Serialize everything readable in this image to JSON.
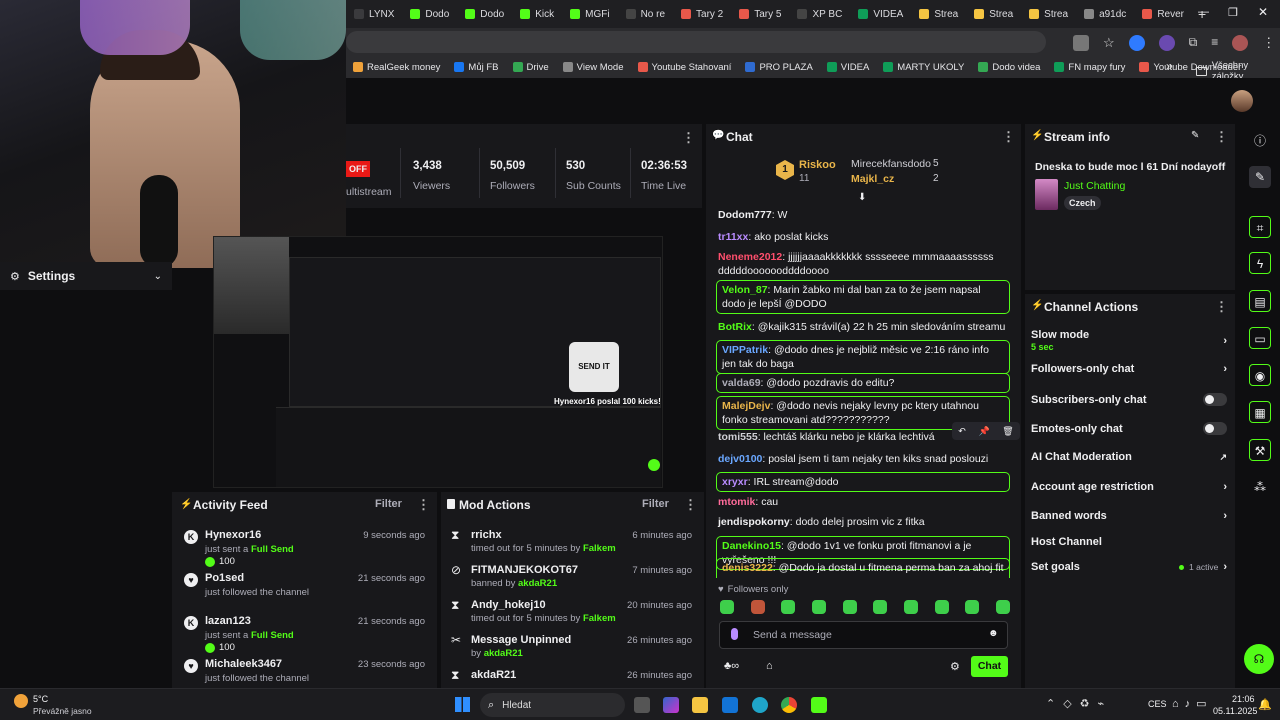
{
  "browser": {
    "tabs": [
      "LYNX",
      "Dodo",
      "Dodo",
      "Kick",
      "MGFi",
      "No re",
      "Tary 2",
      "Tary 5",
      "XP BC",
      "VIDEA",
      "Strea",
      "Strea",
      "Strea",
      "a91dc",
      "Rever"
    ],
    "new_tab": "+",
    "bookmarks": [
      "RealGeek money",
      "Můj FB",
      "Drive",
      "View Mode",
      "Youtube Stahovaní",
      "PRO PLAZA",
      "VIDEA",
      "MARTY UKOLY",
      "Dodo videa",
      "FN mapy fury",
      "Youtube Downloader"
    ],
    "bookmarks_more": "»",
    "all_bookmarks": "Všechny záložky"
  },
  "settings": {
    "label": "Settings"
  },
  "stats": {
    "multistream": "ultistream",
    "off_badge": "OFF",
    "items": [
      {
        "value": "3,438",
        "label": "Viewers"
      },
      {
        "value": "50,509",
        "label": "Followers"
      },
      {
        "value": "530",
        "label": "Sub Counts"
      },
      {
        "value": "02:36:53",
        "label": "Time Live"
      }
    ]
  },
  "preview": {
    "overlay_text": "Hynexor16 poslal 100 kicks!",
    "sendit": "SEND IT"
  },
  "activity": {
    "title": "Activity Feed",
    "filter": "Filter",
    "rows": [
      {
        "name": "Hynexor16",
        "text": "just sent a",
        "highlight": "Full Send",
        "amount": "100",
        "time": "9 seconds ago"
      },
      {
        "name": "Po1sed",
        "text": "just followed the channel",
        "time": "21 seconds ago"
      },
      {
        "name": "lazan123",
        "text": "just sent a",
        "highlight": "Full Send",
        "amount": "100",
        "time": "21 seconds ago"
      },
      {
        "name": "Michaleek3467",
        "text": "just followed the channel",
        "time": "23 seconds ago"
      }
    ]
  },
  "mod_actions": {
    "title": "Mod Actions",
    "filter": "Filter",
    "rows": [
      {
        "name": "rrichx",
        "text": "timed out for 5 minutes by",
        "by": "Falkem",
        "time": "6 minutes ago"
      },
      {
        "name": "FITMANJEKOKOT67",
        "text": "banned by",
        "by": "akdaR21",
        "time": "7 minutes ago"
      },
      {
        "name": "Andy_hokej10",
        "text": "timed out for 5 minutes by",
        "by": "Falkem",
        "time": "20 minutes ago"
      },
      {
        "name": "Message Unpinned",
        "text": "by",
        "by": "akdaR21",
        "time": "26 minutes ago"
      },
      {
        "name": "akdaR21",
        "text": "",
        "by": "",
        "time": "26 minutes ago"
      }
    ]
  },
  "chat": {
    "title": "Chat",
    "leaderboard": {
      "first": "Riskoo",
      "first_count": "11",
      "first_rank": "1",
      "second": "Mirecekfansdodo",
      "second_count": "5",
      "third": "Majkl_cz",
      "third_count": "2"
    },
    "messages": [
      {
        "user": "Dodom777",
        "color": "#efeff1",
        "text": "W",
        "boxed": false
      },
      {
        "user": "tr11xx",
        "color": "#b98cff",
        "text": "ako poslat kicks",
        "boxed": false
      },
      {
        "user": "Neneme2012",
        "color": "#ff4f6d",
        "text": "jjjjjjaaaakkkkkkk sssseeee mmmaaaassssss dddddooooooddddoooo",
        "boxed": false
      },
      {
        "user": "Velon_87",
        "color": "#53fc18",
        "text": "Marin žabko mi dal ban za to že jsem napsal dodo je lepšÍ @DODO",
        "boxed": true
      },
      {
        "user": "BotRix",
        "color": "#53fc18",
        "text": "@kajik315 strávil(a) 22 h 25 min sledováním streamu",
        "boxed": false
      },
      {
        "user": "VIPPatrik",
        "color": "#6aa7ff",
        "text": "@dodo dnes je nejbliž měsic ve 2:16 ráno info jen tak do baga",
        "boxed": true
      },
      {
        "user": "valda69",
        "color": "#adadb8",
        "text": "@dodo pozdravis do editu?",
        "boxed": true
      },
      {
        "user": "MalejDejv",
        "color": "#e9b54a",
        "text": "@dodo nevis nejaky levny pc ktery utahnou fonko streamovani atd???????????",
        "boxed": true
      },
      {
        "user": "tomi555",
        "color": "#cfcfd5",
        "text": "lechtáš klárku nebo je klárka lechtivá",
        "boxed": false
      },
      {
        "user": "dejv0100",
        "color": "#6aa7ff",
        "text": "poslal jsem ti tam nejaky ten kiks snad poslouzi",
        "boxed": false
      },
      {
        "user": "xryxr",
        "color": "#b98cff",
        "text": "IRL stream@dodo",
        "boxed": true
      },
      {
        "user": "mtomik",
        "color": "#ff6b9a",
        "text": "cau",
        "boxed": false
      },
      {
        "user": "jendispokorny",
        "color": "#efeff1",
        "text": "dodo delej prosim vic z fitka",
        "boxed": false
      },
      {
        "user": "Danekino15",
        "color": "#53fc18",
        "text": "@dodo 1v1 ve fonku proti fitmanovi a je vyřešeno !!!",
        "boxed": true
      },
      {
        "user": "denis3222",
        "color": "#e9b54a",
        "text": "@Dodo ja dostal u fitmena perma ban za ahoj fit man",
        "boxed": true
      }
    ],
    "followers_only": "Followers only",
    "input_placeholder": "Send a message",
    "send": "Chat"
  },
  "stream_info": {
    "title": "Stream info",
    "stream_title": "Dneska to bude moc l 61 Dní nodayoff",
    "category": "Just Chatting",
    "language": "Czech"
  },
  "channel_actions": {
    "title": "Channel Actions",
    "slow_mode": "Slow mode",
    "slow_value": "5 sec",
    "items": [
      "Followers-only chat",
      "Subscribers-only chat",
      "Emotes-only chat",
      "AI Chat Moderation",
      "Account age restriction",
      "Banned words",
      "Host Channel",
      "Set goals"
    ],
    "goals_active": "1 active"
  },
  "taskbar": {
    "temp": "5°C",
    "weather": "Převážně jasno",
    "search": "Hledat",
    "lang": "CES",
    "time": "21:06",
    "date": "05.11.2025"
  },
  "colors": {
    "accent": "#53fc18",
    "panel": "#18181b",
    "bg": "#0e0e10"
  }
}
